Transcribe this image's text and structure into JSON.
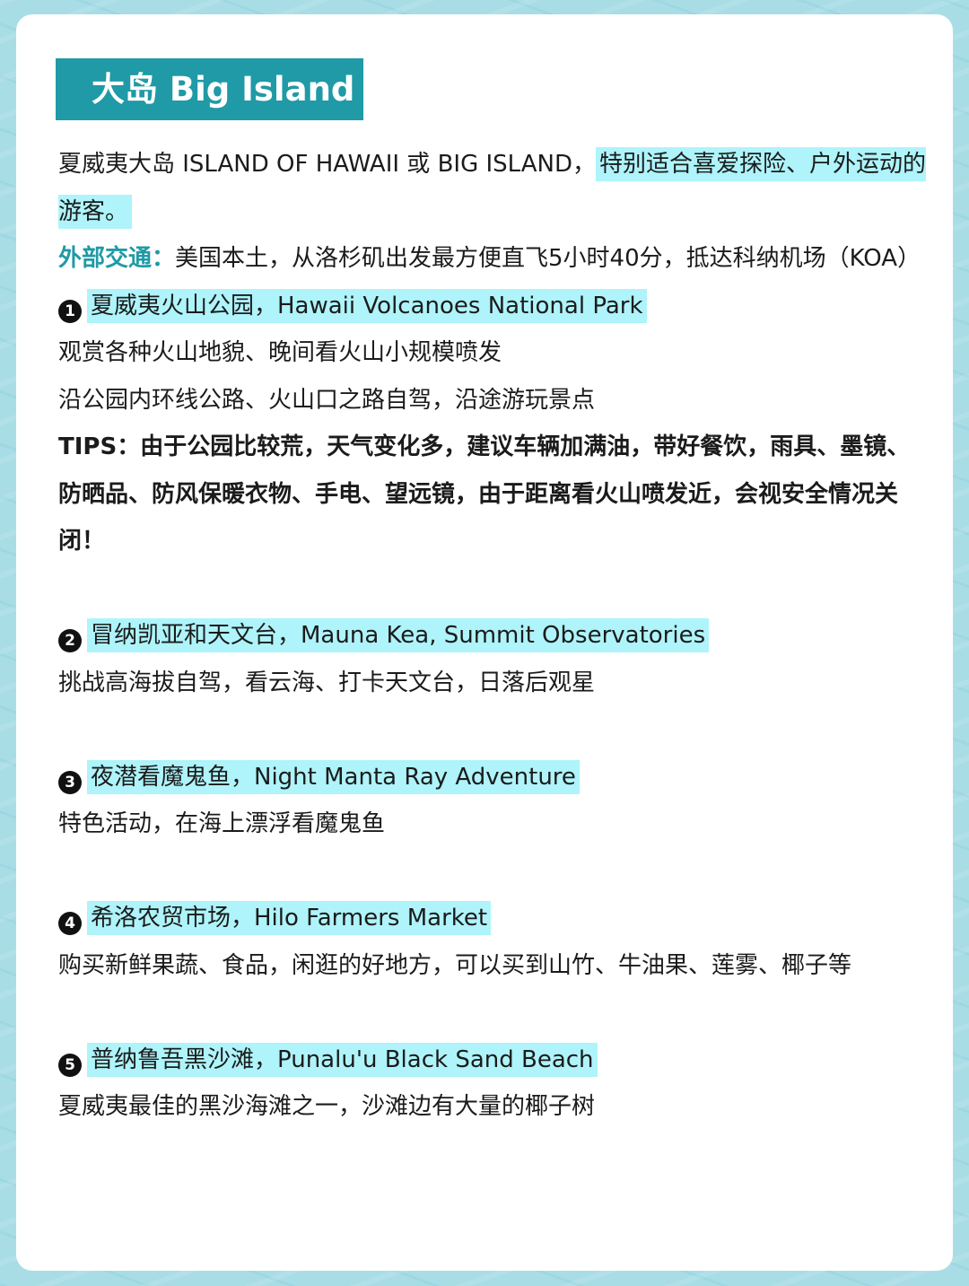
{
  "title": "大岛 Big Island",
  "intro": {
    "text": "夏威夷大岛 ISLAND OF HAWAII 或 BIG ISLAND，",
    "highlight": "特别适合喜爱探险、户外运动的游客。"
  },
  "transport": {
    "label": "外部交通：",
    "text": "美国本土，从洛杉矶出发最方便直飞5小时40分，抵达科纳机场（KOA）"
  },
  "sections": [
    {
      "num": "1",
      "heading": "夏威夷火山公园，Hawaii Volcanoes National Park",
      "lines": [
        "观赏各种火山地貌、晚间看火山小规模喷发",
        "沿公园内环线公路、火山口之路自驾，沿途游玩景点"
      ],
      "tips": "TIPS：由于公园比较荒，天气变化多，建议车辆加满油，带好餐饮，雨具、墨镜、防晒品、防风保暖衣物、手电、望远镜，由于距离看火山喷发近，会视安全情况关闭！"
    },
    {
      "num": "2",
      "heading": "冒纳凯亚和天文台，Mauna Kea, Summit Observatories",
      "lines": [
        "挑战高海拔自驾，看云海、打卡天文台，日落后观星"
      ]
    },
    {
      "num": "3",
      "heading": "夜潜看魔鬼鱼，Night Manta Ray Adventure",
      "lines": [
        "特色活动，在海上漂浮看魔鬼鱼"
      ]
    },
    {
      "num": "4",
      "heading": "希洛农贸市场，Hilo Farmers Market",
      "lines": [
        "购买新鲜果蔬、食品，闲逛的好地方，可以买到山竹、牛油果、莲雾、椰子等"
      ]
    },
    {
      "num": "5",
      "heading": "普纳鲁吾黑沙滩，Punalu'u Black Sand Beach",
      "lines": [
        "夏威夷最佳的黑沙海滩之一，沙滩边有大量的椰子树"
      ]
    }
  ],
  "colors": {
    "background": "#a9dde6",
    "accent": "#1f9aa6",
    "highlight": "#aef4fa",
    "card": "#ffffff"
  }
}
